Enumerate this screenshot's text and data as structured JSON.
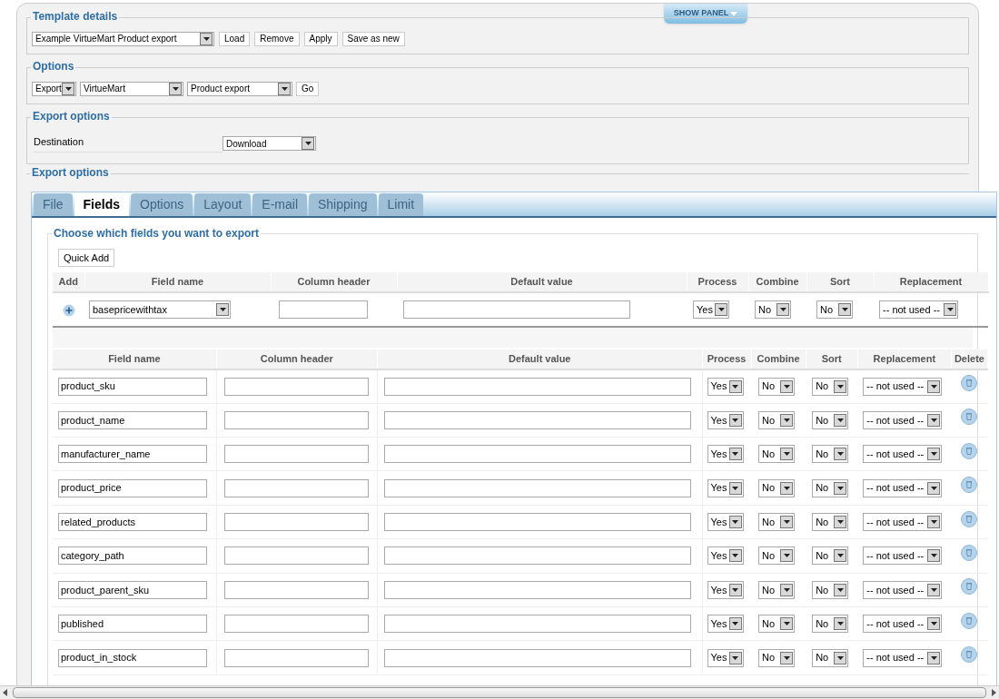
{
  "show_panel": "SHOW PANEL",
  "template_details": {
    "title": "Template details",
    "template_select": "Example VirtueMart Product export",
    "buttons": [
      "Load",
      "Remove",
      "Apply",
      "Save as new"
    ]
  },
  "options": {
    "title": "Options",
    "selects": [
      "Export",
      "VirtueMart",
      "Product export"
    ],
    "go_button": "Go"
  },
  "export_options": {
    "title": "Export options",
    "destination_label": "Destination",
    "destination_select": "Download"
  },
  "export_panel": {
    "title": "Export options",
    "tabs": [
      {
        "label": "File",
        "selected": false
      },
      {
        "label": "Fields",
        "selected": true
      },
      {
        "label": "Options",
        "selected": false
      },
      {
        "label": "Layout",
        "selected": false
      },
      {
        "label": "E-mail",
        "selected": false
      },
      {
        "label": "Shipping",
        "selected": false
      },
      {
        "label": "Limit",
        "selected": false
      }
    ],
    "fieldset_title": "Choose which fields you want to export",
    "quick_add": "Quick Add",
    "add_table": {
      "columns": [
        "Add",
        "Field name",
        "Column header",
        "Default value",
        "Process",
        "Combine",
        "Sort",
        "Replacement"
      ],
      "row": {
        "field_name": "basepricewithtax",
        "process": "Yes",
        "combine": "No",
        "sort": "No",
        "replacement": "-- not used --"
      }
    },
    "fields_table": {
      "columns": [
        "Field name",
        "Column header",
        "Default value",
        "Process",
        "Combine",
        "Sort",
        "Replacement",
        "Delete"
      ],
      "rows": [
        {
          "field_name": "product_sku",
          "process": "Yes",
          "combine": "No",
          "sort": "No",
          "replacement": "-- not used --"
        },
        {
          "field_name": "product_name",
          "process": "Yes",
          "combine": "No",
          "sort": "No",
          "replacement": "-- not used --"
        },
        {
          "field_name": "manufacturer_name",
          "process": "Yes",
          "combine": "No",
          "sort": "No",
          "replacement": "-- not used --"
        },
        {
          "field_name": "product_price",
          "process": "Yes",
          "combine": "No",
          "sort": "No",
          "replacement": "-- not used --"
        },
        {
          "field_name": "related_products",
          "process": "Yes",
          "combine": "No",
          "sort": "No",
          "replacement": "-- not used --"
        },
        {
          "field_name": "category_path",
          "process": "Yes",
          "combine": "No",
          "sort": "No",
          "replacement": "-- not used --"
        },
        {
          "field_name": "product_parent_sku",
          "process": "Yes",
          "combine": "No",
          "sort": "No",
          "replacement": "-- not used --"
        },
        {
          "field_name": "published",
          "process": "Yes",
          "combine": "No",
          "sort": "No",
          "replacement": "-- not used --"
        },
        {
          "field_name": "product_in_stock",
          "process": "Yes",
          "combine": "No",
          "sort": "No",
          "replacement": "-- not used --"
        }
      ]
    }
  }
}
